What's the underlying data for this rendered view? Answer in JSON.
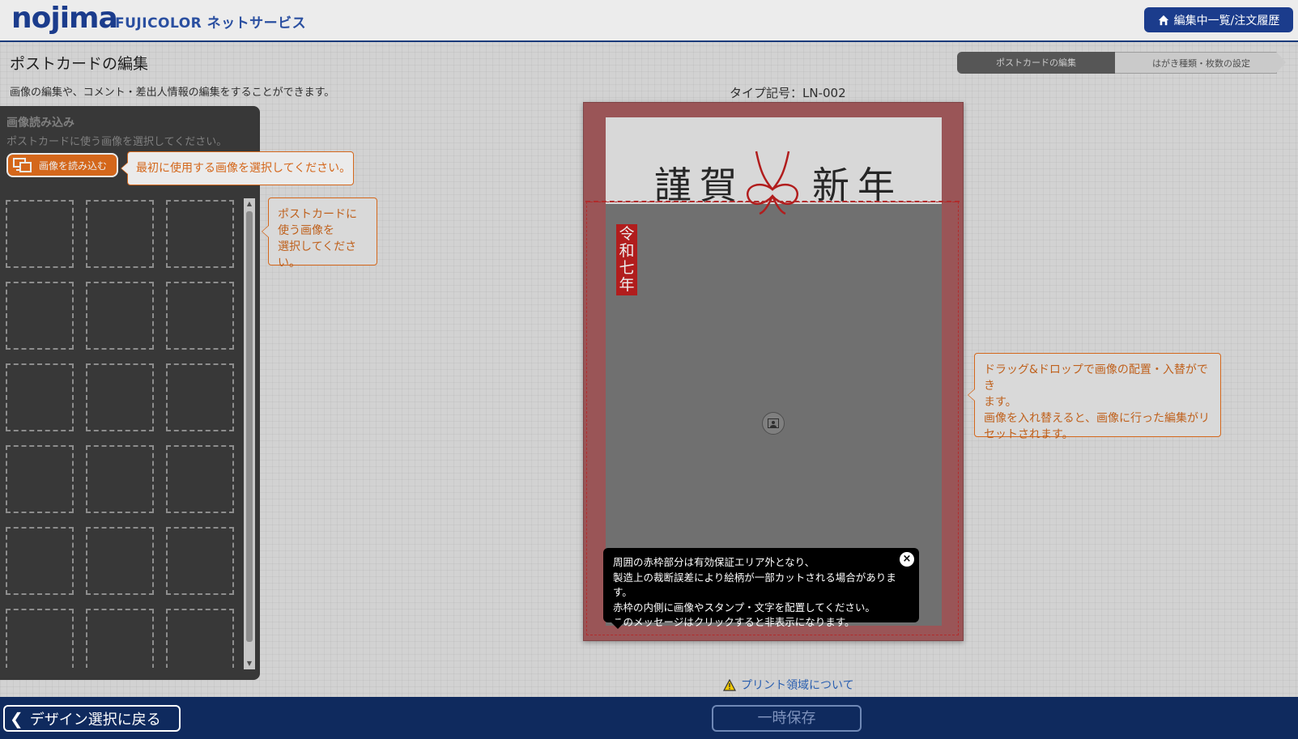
{
  "header": {
    "logo": "nojima",
    "subtitle": "FUJICOLOR ネットサービス",
    "history_button": "編集中一覧/注文履歴"
  },
  "page": {
    "title": "ポストカードの編集",
    "description": "画像の編集や、コメント・差出人情報の編集をすることができます。"
  },
  "steps": [
    {
      "label": "ポストカードの編集",
      "active": true
    },
    {
      "label": "はがき種類・枚数の設定",
      "active": false
    }
  ],
  "left_panel": {
    "title": "画像読み込み",
    "subtitle": "ポストカードに使う画像を選択してください。",
    "load_button": "画像を読み込む",
    "thumbnail_count": 18
  },
  "tips": {
    "load": "最初に使用する画像を選択してください。",
    "thumb_lines": [
      "ポストカードに",
      "使う画像を",
      "選択してください。"
    ],
    "drag_lines": [
      "ドラッグ&ドロップで画像の配置・入替ができ",
      "ます。",
      "画像を入れ替えると、画像に行った編集がリ",
      "セットされます。"
    ]
  },
  "card": {
    "type_code": "タイプ記号：LN-002",
    "greeting_left": "謹賀",
    "greeting_right": "新年",
    "era": "令和七年",
    "border_color": "#a85d5f"
  },
  "notice": {
    "lines": [
      "周囲の赤枠部分は有効保証エリア外となり、",
      "製造上の裁断誤差により絵柄が一部カットされる場合があります。",
      "赤枠の内側に画像やスタンプ・文字を配置してください。",
      "このメッセージはクリックすると非表示になります。"
    ],
    "close": "×"
  },
  "print_area_link": "プリント領域について",
  "footer": {
    "back_button": "デザイン選択に戻る",
    "save_button": "一時保存"
  },
  "colors": {
    "brand": "#1b3c8c",
    "accent": "#e6701e",
    "footer": "#0f2a5e"
  }
}
